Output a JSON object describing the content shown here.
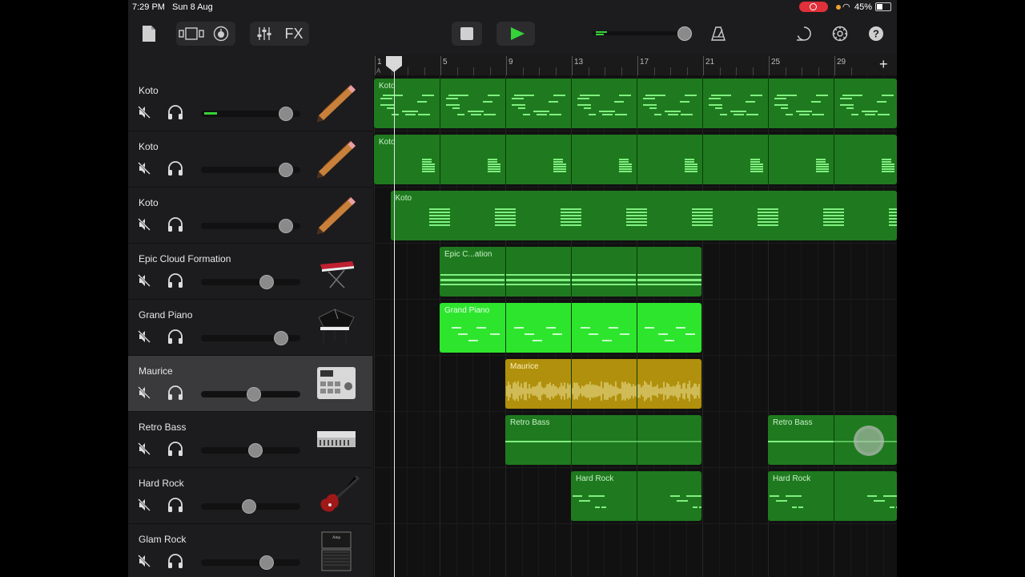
{
  "status_bar": {
    "time": "7:29 PM",
    "date": "Sun 8 Aug",
    "battery": "45%"
  },
  "toolbar": {
    "fx_label": "FX"
  },
  "ruler": {
    "bars": [
      "1",
      "5",
      "9",
      "13",
      "17",
      "21",
      "25",
      "29"
    ],
    "marker": "A",
    "add_label": "+"
  },
  "tracks": [
    {
      "name": "Koto",
      "instrument": "pencil-koto-icon",
      "volume": 0.9
    },
    {
      "name": "Koto",
      "instrument": "pencil-koto-icon",
      "volume": 0.9
    },
    {
      "name": "Koto",
      "instrument": "pencil-koto-icon",
      "volume": 0.9
    },
    {
      "name": "Epic Cloud Formation",
      "instrument": "synth-keyboard-icon",
      "volume": 0.68
    },
    {
      "name": "Grand Piano",
      "instrument": "grand-piano-icon",
      "volume": 0.84
    },
    {
      "name": "Maurice",
      "instrument": "drum-machine-icon",
      "volume": 0.53
    },
    {
      "name": "Retro Bass",
      "instrument": "analog-synth-icon",
      "volume": 0.55
    },
    {
      "name": "Hard Rock",
      "instrument": "electric-guitar-icon",
      "volume": 0.47
    },
    {
      "name": "Glam Rock",
      "instrument": "amp-stack-icon",
      "volume": 0.68
    }
  ],
  "regions": [
    {
      "label": "Koto"
    },
    {
      "label": "Koto"
    },
    {
      "label": "Koto"
    },
    {
      "label": "Epic C...ation"
    },
    {
      "label": "Grand Piano"
    },
    {
      "label": "Maurice"
    },
    {
      "label": "Retro Bass"
    },
    {
      "label": "Retro Bass"
    },
    {
      "label": "Hard Rock"
    },
    {
      "label": "Hard Rock"
    }
  ],
  "colors": {
    "midi_region": "#1f7a1f",
    "piano_region": "#2ee52e",
    "audio_region": "#b0900c",
    "accent": "#35d33a"
  }
}
